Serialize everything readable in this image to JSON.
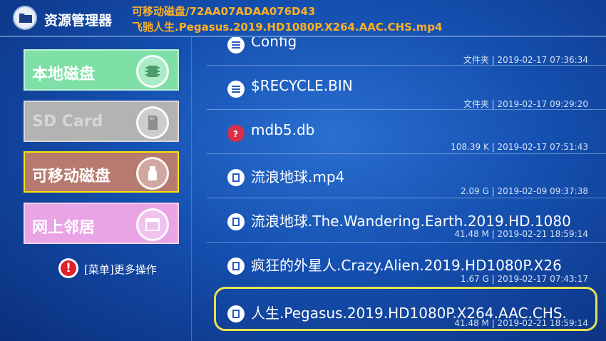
{
  "header": {
    "app_title": "资源管理器",
    "path_line1": "可移动磁盘/72AA07ADAA076D43",
    "path_line2": "飞驰人生.Pegasus.2019.HD1080P.X264.AAC.CHS.mp4"
  },
  "sidebar": {
    "items": [
      {
        "label": "本地磁盘",
        "icon": "memory-chip-icon",
        "color": "#7ee0a6"
      },
      {
        "label": "SD Card",
        "icon": "sd-card-icon",
        "color": "#b3b3b3",
        "disabled": true
      },
      {
        "label": "可移动磁盘",
        "icon": "usb-drive-icon",
        "color": "#b77a6f",
        "selected": true
      },
      {
        "label": "网上邻居",
        "icon": "network-window-icon",
        "color": "#e9a4e6"
      }
    ],
    "menu_hint": "[菜单]更多操作"
  },
  "files": [
    {
      "name": "Config",
      "meta": "文件夹 | 2019-02-17 07:36:34",
      "icon": "folder-list-icon"
    },
    {
      "name": "$RECYCLE.BIN",
      "meta": "文件夹 | 2019-02-17 09:29:20",
      "icon": "folder-list-icon"
    },
    {
      "name": "mdb5.db",
      "meta": "108.39 K | 2019-02-17 07:51:43",
      "icon": "unknown-file-icon"
    },
    {
      "name": "流浪地球.mp4",
      "meta": "2.09 G | 2019-02-09 09:37:38",
      "icon": "video-file-icon"
    },
    {
      "name": "流浪地球.The.Wandering.Earth.2019.HD.1080",
      "meta": "41.48 M | 2019-02-21 18:59:14",
      "icon": "video-file-icon"
    },
    {
      "name": "疯狂的外星人.Crazy.Alien.2019.HD1080P.X26",
      "meta": "1.67 G | 2019-02-17 07:43:17",
      "icon": "video-file-icon"
    },
    {
      "name": "人生.Pegasus.2019.HD1080P.X264.AAC.CHS.",
      "meta": "41.48 M | 2019-02-21 18:59:14",
      "icon": "video-file-icon",
      "selected": true
    }
  ],
  "colors": {
    "accent": "#ffb020",
    "selection": "#e8e34a",
    "background": "#1550b0"
  }
}
